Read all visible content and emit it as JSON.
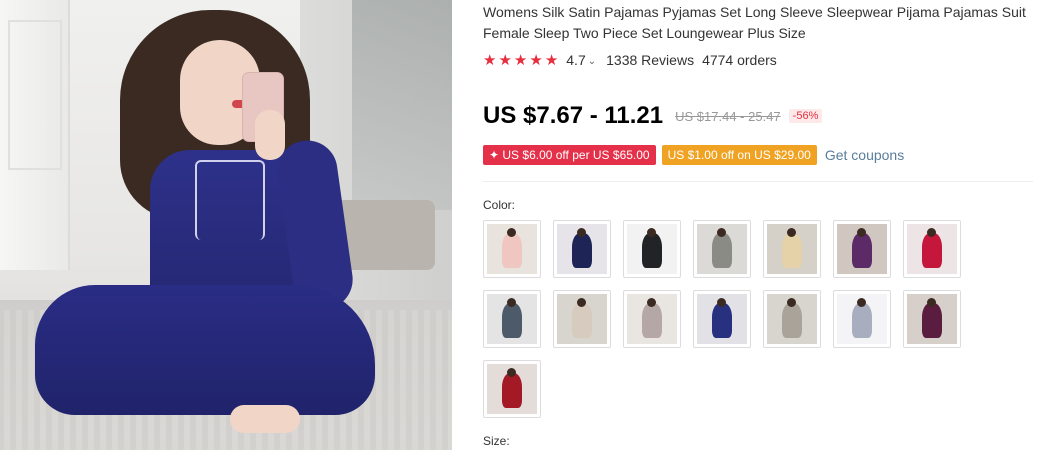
{
  "product": {
    "title": "Womens Silk Satin Pajamas Pyjamas Set Long Sleeve Sleepwear Pijama Pajamas Suit Female Sleep Two Piece Set Loungewear Plus Size",
    "rating": "4.7",
    "rating_value": 4.7,
    "reviews": "1338 Reviews",
    "orders": "4774 orders",
    "price": "US $7.67 - 11.21",
    "old_price": "US $17.44 - 25.47",
    "discount": "-56%"
  },
  "coupons": [
    {
      "label": "✦ US $6.00 off per US $65.00",
      "color": "#e5304a"
    },
    {
      "label": "US $1.00 off on US $29.00",
      "color": "#f0a323"
    }
  ],
  "coupon_link": "Get coupons",
  "color_label": "Color:",
  "size_label": "Size:",
  "swatches": [
    {
      "bg": "#e9e3dd",
      "fig": "#f0c6c0"
    },
    {
      "bg": "#e6e4e8",
      "fig": "#1f2457"
    },
    {
      "bg": "#f2f2f2",
      "fig": "#222326"
    },
    {
      "bg": "#dcdad6",
      "fig": "#8b8b86"
    },
    {
      "bg": "#d6d1c8",
      "fig": "#e6d2a9"
    },
    {
      "bg": "#cfc7c0",
      "fig": "#5b2a67"
    },
    {
      "bg": "#ece4e5",
      "fig": "#c4173b"
    },
    {
      "bg": "#e4e4e4",
      "fig": "#4d5a6a"
    },
    {
      "bg": "#d8d4ce",
      "fig": "#d7cabe"
    },
    {
      "bg": "#e9e6e2",
      "fig": "#b5a7a6"
    },
    {
      "bg": "#e2e2e6",
      "fig": "#283080"
    },
    {
      "bg": "#d8d5cf",
      "fig": "#a9a39a"
    },
    {
      "bg": "#f4f4f6",
      "fig": "#a8aec0"
    },
    {
      "bg": "#d6cfca",
      "fig": "#5a1d3f"
    },
    {
      "bg": "#e3dcd8",
      "fig": "#a31a26"
    }
  ],
  "colors": {
    "star": "#e62e3e",
    "link": "#5b7d9b",
    "discount_text": "#e62e3e"
  },
  "icons": {
    "star": "star-icon",
    "chevron": "chevron-down-icon"
  }
}
